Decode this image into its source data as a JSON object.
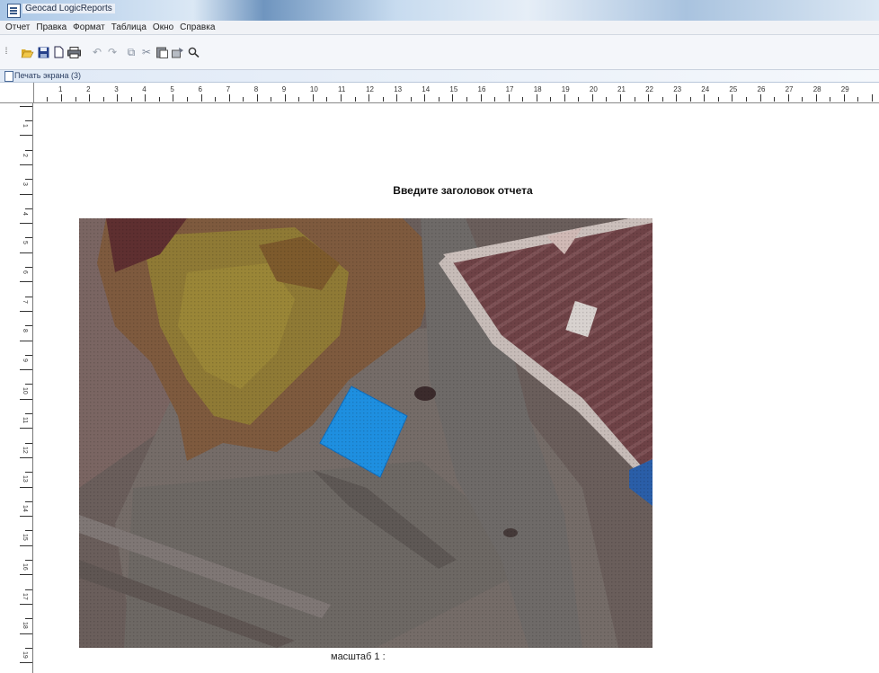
{
  "window": {
    "title": "Geocad LogicReports"
  },
  "menu": {
    "items": [
      "Отчет",
      "Правка",
      "Формат",
      "Таблица",
      "Окно",
      "Справка"
    ]
  },
  "toolbar": {
    "buttons": [
      {
        "name": "open-icon",
        "glyph": "📂"
      },
      {
        "name": "save-icon",
        "glyph": "💾"
      },
      {
        "name": "new-document-icon",
        "glyph": "🗋"
      },
      {
        "name": "print-icon",
        "glyph": "🖶"
      },
      {
        "name": "undo-icon",
        "glyph": "↶"
      },
      {
        "name": "redo-icon",
        "glyph": "↷"
      },
      {
        "name": "copy-icon",
        "glyph": "⧉"
      },
      {
        "name": "cut-icon",
        "glyph": "✂"
      },
      {
        "name": "paste-icon",
        "glyph": "📋"
      },
      {
        "name": "format-icon",
        "glyph": "🖌"
      },
      {
        "name": "zoom-icon",
        "glyph": "🔍"
      }
    ]
  },
  "document": {
    "window_title": "Печать экрана (3)"
  },
  "ruler": {
    "top_numbers": [
      "1",
      "2",
      "3",
      "4",
      "5",
      "6",
      "7",
      "8",
      "9",
      "10",
      "11",
      "12",
      "13",
      "14",
      "15",
      "16",
      "17",
      "18",
      "19",
      "20",
      "21",
      "22",
      "23",
      "24",
      "25",
      "26",
      "27",
      "28",
      "29"
    ],
    "left_numbers": [
      "1",
      "2",
      "3",
      "4",
      "5",
      "6",
      "7",
      "8",
      "9",
      "10",
      "11",
      "12",
      "13",
      "14",
      "15",
      "16",
      "17",
      "18",
      "19"
    ]
  },
  "report": {
    "title": "Введите заголовок отчета",
    "scale_label": "масштаб 1 :"
  },
  "colors": {
    "selected_parcel": "#1e8fe0",
    "accent": "#3a5a88"
  }
}
